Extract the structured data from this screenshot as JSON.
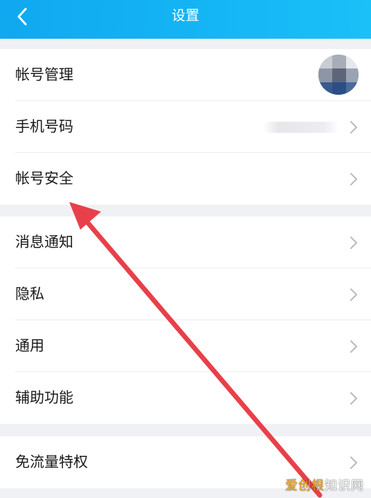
{
  "header": {
    "title": "设置",
    "background": "#14b4f4"
  },
  "groups": [
    {
      "items": [
        {
          "label": "帐号管理"
        },
        {
          "label": "手机号码"
        },
        {
          "label": "帐号安全"
        }
      ]
    },
    {
      "items": [
        {
          "label": "消息通知"
        },
        {
          "label": "隐私"
        },
        {
          "label": "通用"
        },
        {
          "label": "辅助功能"
        }
      ]
    },
    {
      "items": [
        {
          "label": "免流量特权"
        }
      ]
    }
  ],
  "icons": {
    "back": "chevron-left-icon",
    "row_arrow": "chevron-right-icon"
  },
  "annotation": {
    "color": "#e8404a",
    "points_to": "帐号安全"
  },
  "watermark": {
    "brand_part": "爱创根",
    "rest_part": "知识网"
  }
}
